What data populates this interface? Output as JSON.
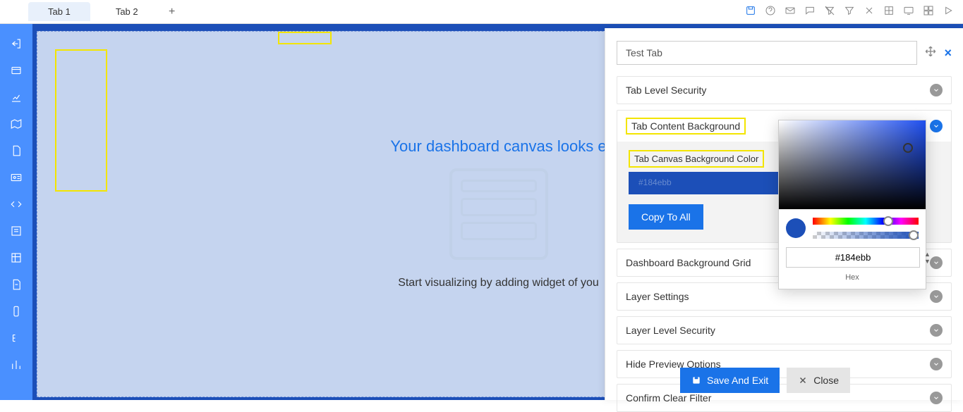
{
  "tabs": {
    "tab1": "Tab 1",
    "tab2": "Tab 2"
  },
  "canvas": {
    "title": "Your dashboard canvas looks e",
    "subtitle": "Start visualizing by adding widget of you"
  },
  "panel": {
    "tabNameValue": "Test Tab",
    "sections": {
      "security": "Tab Level Security",
      "bg": "Tab Content Background",
      "canvasColor": "Tab Canvas Background Color",
      "swatchLabel": "#184ebb",
      "copyBtn": "Copy To All",
      "grid": "Dashboard Background Grid",
      "layer": "Layer Settings",
      "layerSec": "Layer Level Security",
      "hide": "Hide Preview Options",
      "clear": "Confirm Clear Filter"
    }
  },
  "picker": {
    "hex": "#184ebb",
    "hexLabel": "Hex"
  },
  "footer": {
    "save": "Save And Exit",
    "close": "Close"
  }
}
